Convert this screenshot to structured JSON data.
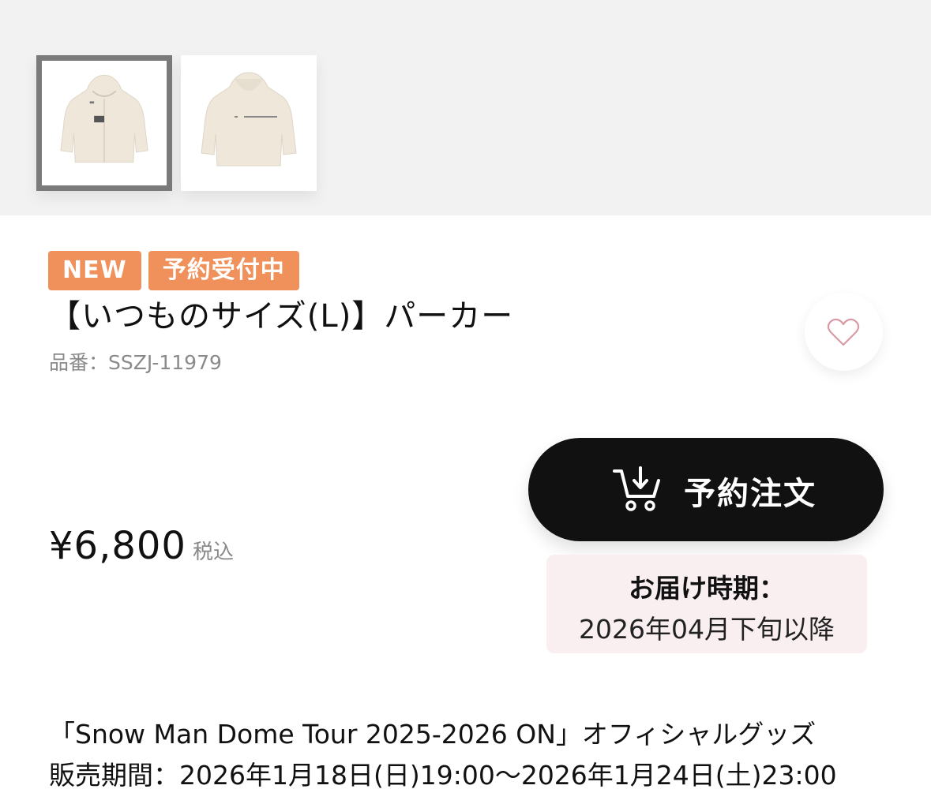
{
  "gallery": {
    "images": [
      {
        "alt": "hoodie-front"
      },
      {
        "alt": "hoodie-back"
      }
    ],
    "selected_index": 0
  },
  "badges": [
    "NEW",
    "予約受付中"
  ],
  "product": {
    "title": "【いつものサイズ(L)】パーカー",
    "sku": "品番：SSZJ-11979",
    "price": "¥6,800",
    "tax_note": "税込"
  },
  "actions": {
    "order_label": "予約注文",
    "favorite_icon": "heart-icon",
    "cart_icon": "cart-download-icon"
  },
  "delivery": {
    "label": "お届け時期：",
    "value": "2026年04月下旬以降"
  },
  "description": {
    "line1": "「Snow Man Dome Tour 2025-2026 ON」オフィシャルグッズ",
    "line2": "販売期間：2026年1月18日(日)19:00～2026年1月24日(土)23:00"
  },
  "colors": {
    "badge": "#f0915c",
    "button": "#111111",
    "delivery_bg": "#f9eff1",
    "gallery_bg": "#f2f2f2"
  }
}
